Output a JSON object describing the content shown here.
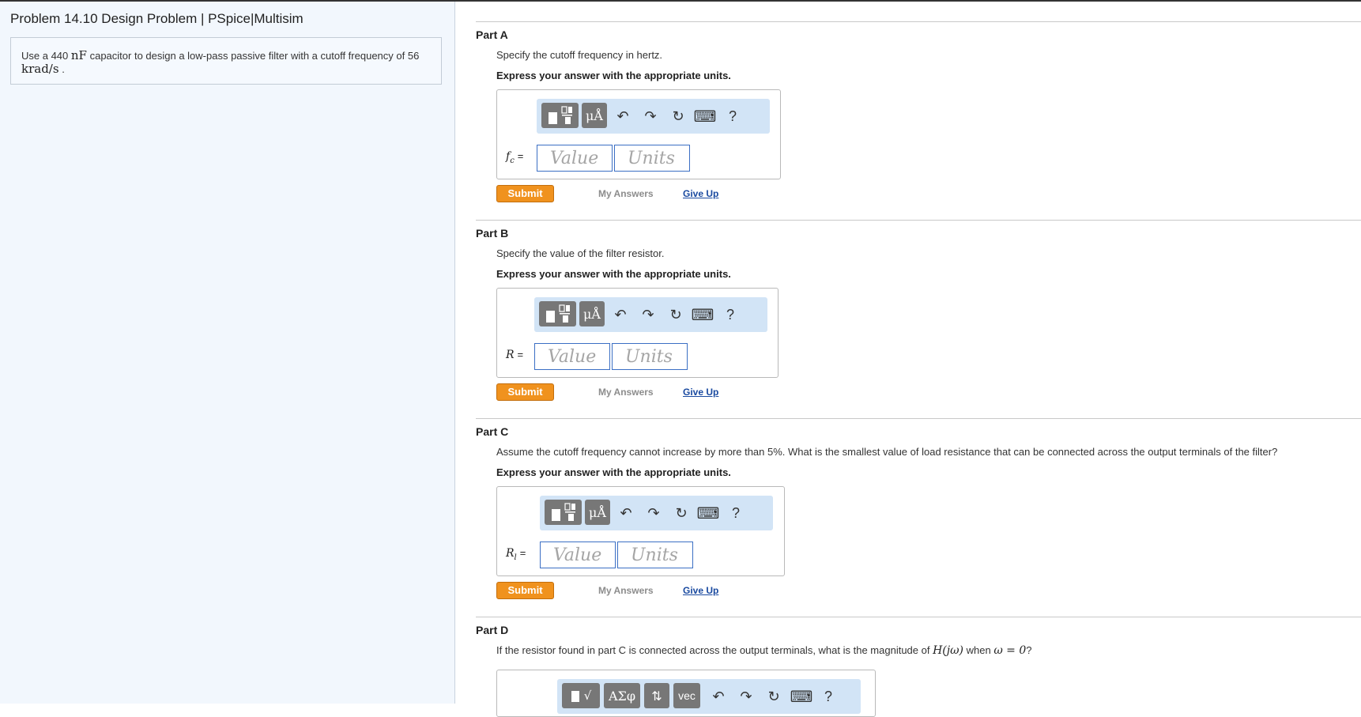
{
  "problem": {
    "title": "Problem 14.10 Design Problem | PSpice|Multisim",
    "statement_prefix": "Use a 440",
    "statement_unit1": "nF",
    "statement_mid": "capacitor to design a low-pass passive filter with a cutoff frequency of 56",
    "statement_unit2": "krad/s",
    "statement_end": "."
  },
  "toolbar": {
    "templates_icon": "templates-icon",
    "units_label": "μÅ",
    "undo_icon": "↶",
    "redo_icon": "↷",
    "reset_icon": "↻",
    "keyboard_icon": "⌨",
    "help_label": "?",
    "sqrt_label": "√",
    "greek_label": "ΑΣφ",
    "arrows_label": "⇅",
    "vec_label": "vec"
  },
  "common": {
    "express": "Express your answer with the appropriate units.",
    "value_placeholder": "Value",
    "units_placeholder": "Units",
    "submit": "Submit",
    "my_answers": "My Answers",
    "give_up": "Give Up"
  },
  "parts": [
    {
      "label": "Part A",
      "prompt": "Specify the cutoff frequency in hertz.",
      "var": "f",
      "sub": "c"
    },
    {
      "label": "Part B",
      "prompt": "Specify the value of the filter resistor.",
      "var": "R",
      "sub": ""
    },
    {
      "label": "Part C",
      "prompt": "Assume the cutoff frequency cannot increase by more than 5%. What is the smallest value of load resistance that can be connected across the output terminals of the filter?",
      "var": "R",
      "sub": "l"
    },
    {
      "label": "Part D",
      "prompt_pre": "If the resistor found in part C is connected across the output terminals, what is the magnitude of",
      "prompt_expr": "H(jω)",
      "prompt_mid": "when",
      "prompt_cond": "ω = 0",
      "prompt_end": "?"
    }
  ]
}
